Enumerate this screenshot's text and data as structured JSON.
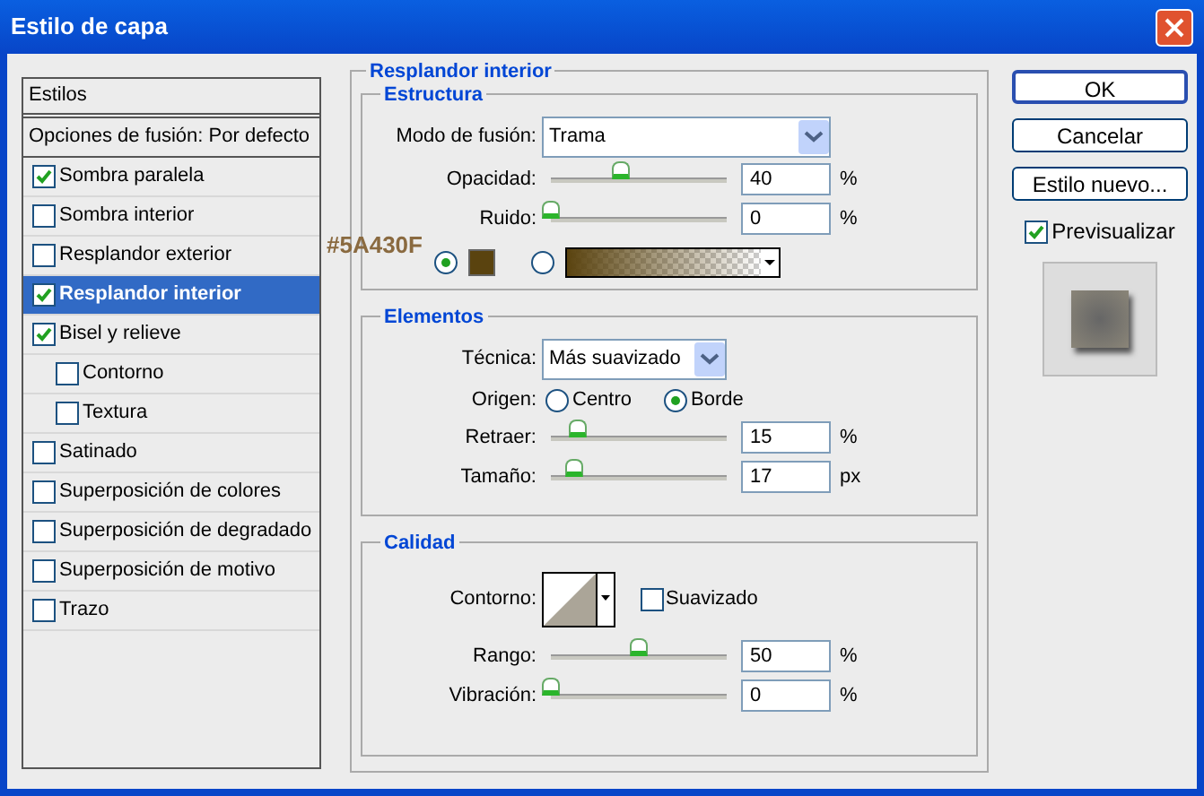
{
  "window": {
    "title": "Estilo de capa"
  },
  "styles_list": {
    "header": "Estilos",
    "blend_options": "Opciones de fusión: Por defecto",
    "items": [
      {
        "label": "Sombra paralela",
        "checked": true,
        "selected": false
      },
      {
        "label": "Sombra interior",
        "checked": false,
        "selected": false
      },
      {
        "label": "Resplandor exterior",
        "checked": false,
        "selected": false
      },
      {
        "label": "Resplandor interior",
        "checked": true,
        "selected": true
      },
      {
        "label": "Bisel y relieve",
        "checked": true,
        "selected": false,
        "children": [
          {
            "label": "Contorno",
            "checked": false,
            "selected": false
          },
          {
            "label": "Textura",
            "checked": false,
            "selected": false
          }
        ]
      },
      {
        "label": "Satinado",
        "checked": false,
        "selected": false
      },
      {
        "label": "Superposición de colores",
        "checked": false,
        "selected": false
      },
      {
        "label": "Superposición de degradado",
        "checked": false,
        "selected": false
      },
      {
        "label": "Superposición de motivo",
        "checked": false,
        "selected": false
      },
      {
        "label": "Trazo",
        "checked": false,
        "selected": false
      }
    ]
  },
  "panel": {
    "title": "Resplandor interior",
    "structure": {
      "title": "Estructura",
      "blend_mode": {
        "label": "Modo de fusión:",
        "value": "Trama"
      },
      "sliders": [
        {
          "label": "Opacidad:",
          "level": 0.4,
          "value": "40",
          "unit": "%"
        },
        {
          "label": "Ruido:",
          "level": 0,
          "value": "0",
          "unit": "%"
        }
      ],
      "color_annotation": "#5A430F",
      "color_options": [
        {
          "kind": "color",
          "selected": true,
          "color": "#5a430f"
        },
        {
          "kind": "gradient",
          "selected": false
        }
      ]
    },
    "elements": {
      "title": "Elementos",
      "technique": {
        "label": "Técnica:",
        "value": "Más suavizado"
      },
      "origin": {
        "label": "Origen:",
        "options": [
          {
            "label": "Centro",
            "selected": false
          },
          {
            "label": "Borde",
            "selected": true
          }
        ]
      },
      "sliders": [
        {
          "label": "Retraer:",
          "level": 0.15,
          "value": "15",
          "unit": "%"
        },
        {
          "label": "Tamaño:",
          "level": 0.13,
          "value": "17",
          "unit": "px"
        }
      ]
    },
    "quality": {
      "title": "Calidad",
      "contour": {
        "label": "Contorno:"
      },
      "antialias": {
        "label": "Suavizado",
        "checked": false
      },
      "sliders": [
        {
          "label": "Rango:",
          "level": 0.5,
          "value": "50",
          "unit": "%"
        },
        {
          "label": "Vibración:",
          "level": 0,
          "value": "0",
          "unit": "%"
        }
      ]
    }
  },
  "buttons": [
    {
      "label": "OK",
      "default": true
    },
    {
      "label": "Cancelar",
      "default": false
    },
    {
      "label": "Estilo nuevo...",
      "default": false
    }
  ],
  "preview": {
    "label": "Previsualizar",
    "checked": true
  }
}
